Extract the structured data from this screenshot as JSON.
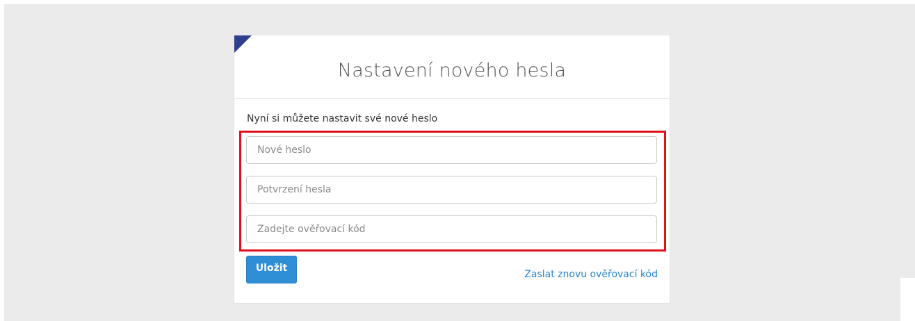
{
  "card": {
    "title": "Nastavení nového hesla",
    "intro": "Nyní si můžete nastavit své nové heslo"
  },
  "fields": {
    "new_password_placeholder": "Nové heslo",
    "confirm_password_placeholder": "Potvrzení hesla",
    "verification_code_placeholder": "Zadejte ověřovací kód"
  },
  "actions": {
    "save_label": "Uložit",
    "resend_label": "Zaslat znovu ověřovací kód"
  },
  "colors": {
    "accent": "#2e8ed6",
    "link": "#2a83c9",
    "highlight": "#e0101a",
    "corner": "#2f3e8e"
  }
}
